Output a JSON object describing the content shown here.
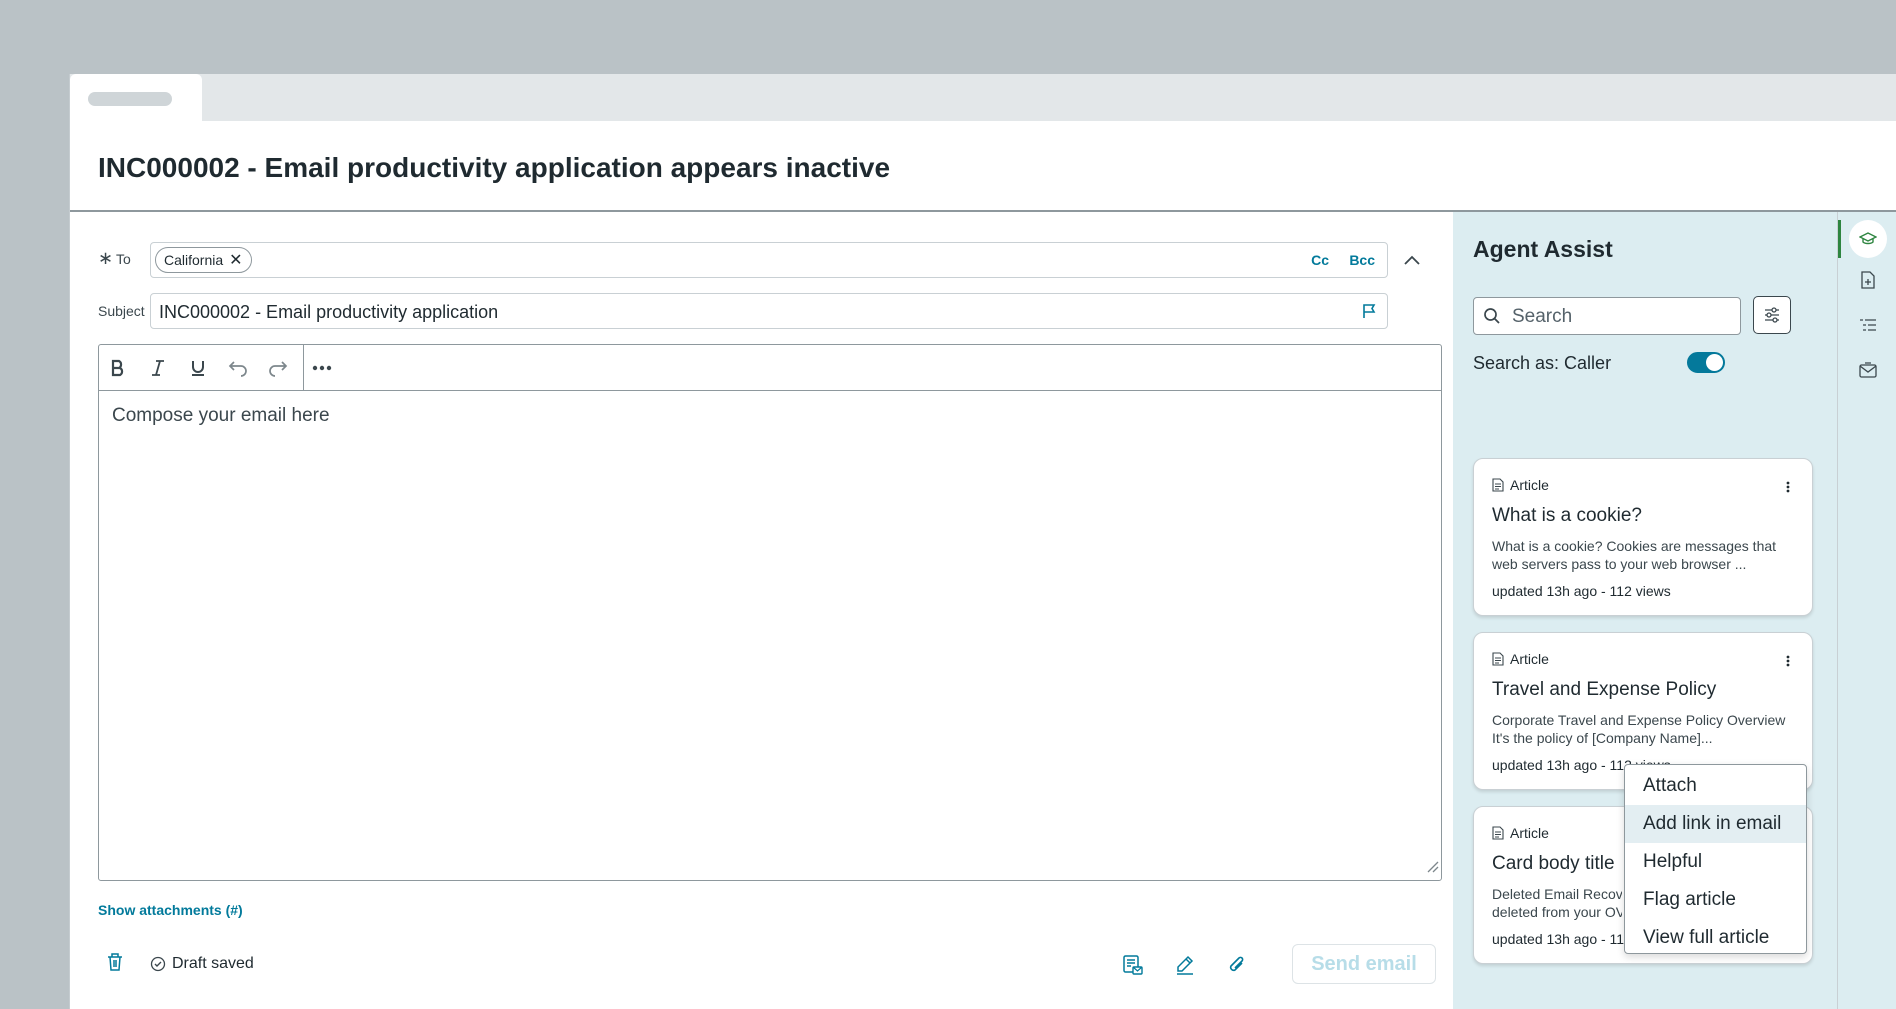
{
  "header": {
    "title": "INC000002 - Email productivity application appears inactive"
  },
  "compose": {
    "to_label": "To",
    "recipients": [
      {
        "label": "California"
      }
    ],
    "cc_label": "Cc",
    "bcc_label": "Bcc",
    "subject_label": "Subject",
    "subject_value": "INC000002 - Email productivity application",
    "body_placeholder": "Compose your email here",
    "show_attachments_label": "Show attachments (#)",
    "draft_status": "Draft saved",
    "send_label": "Send email"
  },
  "assist": {
    "title": "Agent Assist",
    "search_placeholder": "Search",
    "search_as_label": "Search as: Caller",
    "search_as_enabled": true,
    "cards": [
      {
        "type": "Article",
        "title": "What is a cookie?",
        "desc1": "What is a cookie? Cookies are messages that",
        "desc2": "web servers pass to your web browser ...",
        "meta": "updated 13h ago - 112 views"
      },
      {
        "type": "Article",
        "title": "Travel and Expense Policy",
        "desc1": "Corporate Travel and Expense Policy Overview",
        "desc2": "It's the policy of [Company Name]...",
        "meta": "updated 13h ago - 112 views"
      },
      {
        "type": "Article",
        "title": "Card body title",
        "desc1": "Deleted Email Recove",
        "desc2": "deleted from your OV",
        "meta": "updated 13h ago - 11"
      }
    ],
    "menu": {
      "items": [
        "Attach",
        "Add link in email",
        "Helpful",
        "Flag article",
        "View full article"
      ],
      "highlighted": "Add link in email"
    }
  },
  "rail": {
    "icons": [
      "graduation-cap-icon",
      "document-add-icon",
      "list-icon",
      "mail-icon"
    ]
  },
  "colors": {
    "accent": "#027a9b",
    "assist_bg": "#dcedf1",
    "toggle_on": "#04799b"
  }
}
